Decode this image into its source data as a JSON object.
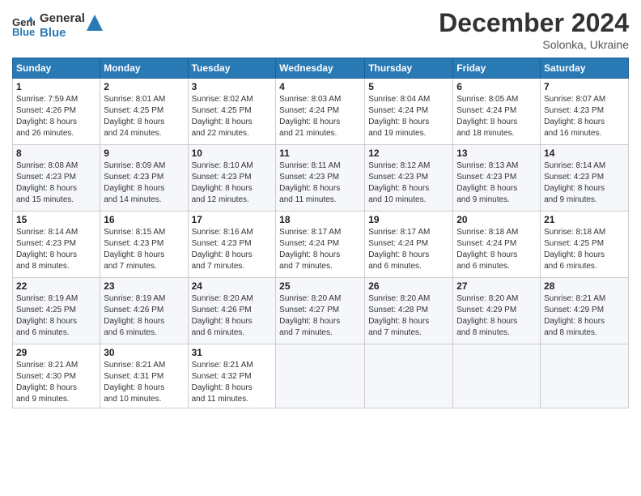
{
  "header": {
    "logo_line1": "General",
    "logo_line2": "Blue",
    "title": "December 2024",
    "subtitle": "Solonka, Ukraine"
  },
  "weekdays": [
    "Sunday",
    "Monday",
    "Tuesday",
    "Wednesday",
    "Thursday",
    "Friday",
    "Saturday"
  ],
  "weeks": [
    [
      {
        "day": "1",
        "info": "Sunrise: 7:59 AM\nSunset: 4:26 PM\nDaylight: 8 hours\nand 26 minutes."
      },
      {
        "day": "2",
        "info": "Sunrise: 8:01 AM\nSunset: 4:25 PM\nDaylight: 8 hours\nand 24 minutes."
      },
      {
        "day": "3",
        "info": "Sunrise: 8:02 AM\nSunset: 4:25 PM\nDaylight: 8 hours\nand 22 minutes."
      },
      {
        "day": "4",
        "info": "Sunrise: 8:03 AM\nSunset: 4:24 PM\nDaylight: 8 hours\nand 21 minutes."
      },
      {
        "day": "5",
        "info": "Sunrise: 8:04 AM\nSunset: 4:24 PM\nDaylight: 8 hours\nand 19 minutes."
      },
      {
        "day": "6",
        "info": "Sunrise: 8:05 AM\nSunset: 4:24 PM\nDaylight: 8 hours\nand 18 minutes."
      },
      {
        "day": "7",
        "info": "Sunrise: 8:07 AM\nSunset: 4:23 PM\nDaylight: 8 hours\nand 16 minutes."
      }
    ],
    [
      {
        "day": "8",
        "info": "Sunrise: 8:08 AM\nSunset: 4:23 PM\nDaylight: 8 hours\nand 15 minutes."
      },
      {
        "day": "9",
        "info": "Sunrise: 8:09 AM\nSunset: 4:23 PM\nDaylight: 8 hours\nand 14 minutes."
      },
      {
        "day": "10",
        "info": "Sunrise: 8:10 AM\nSunset: 4:23 PM\nDaylight: 8 hours\nand 12 minutes."
      },
      {
        "day": "11",
        "info": "Sunrise: 8:11 AM\nSunset: 4:23 PM\nDaylight: 8 hours\nand 11 minutes."
      },
      {
        "day": "12",
        "info": "Sunrise: 8:12 AM\nSunset: 4:23 PM\nDaylight: 8 hours\nand 10 minutes."
      },
      {
        "day": "13",
        "info": "Sunrise: 8:13 AM\nSunset: 4:23 PM\nDaylight: 8 hours\nand 9 minutes."
      },
      {
        "day": "14",
        "info": "Sunrise: 8:14 AM\nSunset: 4:23 PM\nDaylight: 8 hours\nand 9 minutes."
      }
    ],
    [
      {
        "day": "15",
        "info": "Sunrise: 8:14 AM\nSunset: 4:23 PM\nDaylight: 8 hours\nand 8 minutes."
      },
      {
        "day": "16",
        "info": "Sunrise: 8:15 AM\nSunset: 4:23 PM\nDaylight: 8 hours\nand 7 minutes."
      },
      {
        "day": "17",
        "info": "Sunrise: 8:16 AM\nSunset: 4:23 PM\nDaylight: 8 hours\nand 7 minutes."
      },
      {
        "day": "18",
        "info": "Sunrise: 8:17 AM\nSunset: 4:24 PM\nDaylight: 8 hours\nand 7 minutes."
      },
      {
        "day": "19",
        "info": "Sunrise: 8:17 AM\nSunset: 4:24 PM\nDaylight: 8 hours\nand 6 minutes."
      },
      {
        "day": "20",
        "info": "Sunrise: 8:18 AM\nSunset: 4:24 PM\nDaylight: 8 hours\nand 6 minutes."
      },
      {
        "day": "21",
        "info": "Sunrise: 8:18 AM\nSunset: 4:25 PM\nDaylight: 8 hours\nand 6 minutes."
      }
    ],
    [
      {
        "day": "22",
        "info": "Sunrise: 8:19 AM\nSunset: 4:25 PM\nDaylight: 8 hours\nand 6 minutes."
      },
      {
        "day": "23",
        "info": "Sunrise: 8:19 AM\nSunset: 4:26 PM\nDaylight: 8 hours\nand 6 minutes."
      },
      {
        "day": "24",
        "info": "Sunrise: 8:20 AM\nSunset: 4:26 PM\nDaylight: 8 hours\nand 6 minutes."
      },
      {
        "day": "25",
        "info": "Sunrise: 8:20 AM\nSunset: 4:27 PM\nDaylight: 8 hours\nand 7 minutes."
      },
      {
        "day": "26",
        "info": "Sunrise: 8:20 AM\nSunset: 4:28 PM\nDaylight: 8 hours\nand 7 minutes."
      },
      {
        "day": "27",
        "info": "Sunrise: 8:20 AM\nSunset: 4:29 PM\nDaylight: 8 hours\nand 8 minutes."
      },
      {
        "day": "28",
        "info": "Sunrise: 8:21 AM\nSunset: 4:29 PM\nDaylight: 8 hours\nand 8 minutes."
      }
    ],
    [
      {
        "day": "29",
        "info": "Sunrise: 8:21 AM\nSunset: 4:30 PM\nDaylight: 8 hours\nand 9 minutes."
      },
      {
        "day": "30",
        "info": "Sunrise: 8:21 AM\nSunset: 4:31 PM\nDaylight: 8 hours\nand 10 minutes."
      },
      {
        "day": "31",
        "info": "Sunrise: 8:21 AM\nSunset: 4:32 PM\nDaylight: 8 hours\nand 11 minutes."
      },
      {
        "day": "",
        "info": ""
      },
      {
        "day": "",
        "info": ""
      },
      {
        "day": "",
        "info": ""
      },
      {
        "day": "",
        "info": ""
      }
    ]
  ]
}
